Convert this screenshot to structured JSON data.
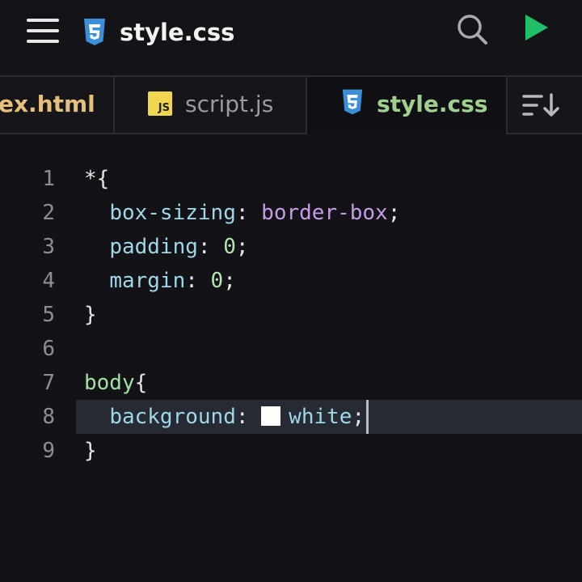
{
  "header": {
    "title": "style.css",
    "icons": {
      "menu": "menu-icon",
      "file": "css3-icon",
      "search": "search-icon",
      "run": "play-icon"
    },
    "colors": {
      "css_icon": "#3b8fd9",
      "run": "#1fbf6a"
    }
  },
  "tabs": [
    {
      "label": "ex.html",
      "icon": "html-icon",
      "active": false
    },
    {
      "label": "script.js",
      "icon": "js-icon",
      "icon_text": "JS",
      "active": false
    },
    {
      "label": "style.css",
      "icon": "css3-icon",
      "active": true
    }
  ],
  "tab_actions": {
    "sort": "sort-icon"
  },
  "editor": {
    "line_numbers": [
      "1",
      "2",
      "3",
      "4",
      "5",
      "6",
      "7",
      "8",
      "9"
    ],
    "lines": {
      "l1": {
        "text": "*{"
      },
      "l2": {
        "prop": "box-sizing",
        "colon": ": ",
        "value": "border-box",
        "semi": ";"
      },
      "l3": {
        "prop": "padding",
        "colon": ": ",
        "value": "0",
        "semi": ";"
      },
      "l4": {
        "prop": "margin",
        "colon": ": ",
        "value": "0",
        "semi": ";"
      },
      "l5": {
        "text": "}"
      },
      "l7": {
        "selector": "body",
        "brace": "{"
      },
      "l8": {
        "prop": "background",
        "colon": ": ",
        "value": "white",
        "semi": ";",
        "swatch_color": "#ffffff"
      },
      "l9": {
        "text": "}"
      }
    },
    "active_line": "8"
  }
}
